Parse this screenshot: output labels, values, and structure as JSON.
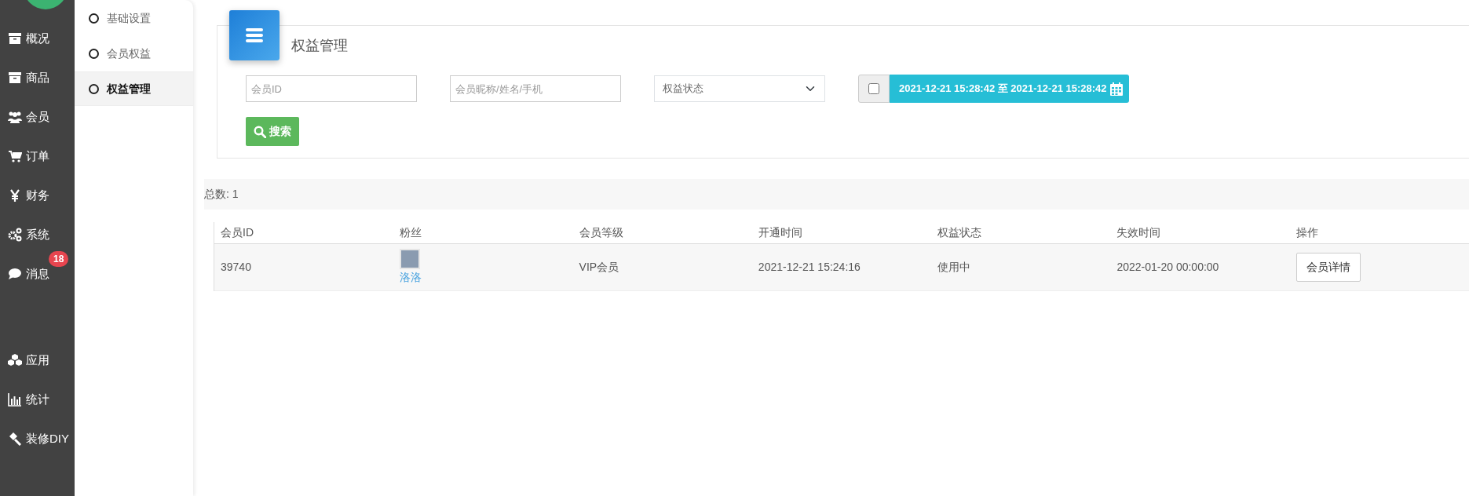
{
  "sidebar": {
    "items": [
      {
        "label": "概况"
      },
      {
        "label": "商品"
      },
      {
        "label": "会员"
      },
      {
        "label": "订单"
      },
      {
        "label": "财务"
      },
      {
        "label": "系统"
      },
      {
        "label": "消息",
        "badge": "18"
      },
      {
        "label": "应用"
      },
      {
        "label": "统计"
      },
      {
        "label": "装修DIY"
      }
    ]
  },
  "submenu": {
    "items": [
      {
        "label": "基础设置",
        "selected": false
      },
      {
        "label": "会员权益",
        "selected": false
      },
      {
        "label": "权益管理",
        "selected": true
      }
    ]
  },
  "panel": {
    "title": "权益管理",
    "filters": {
      "member_id": {
        "placeholder": "会员ID"
      },
      "member_name": {
        "placeholder": "会员昵称/姓名/手机"
      },
      "status": {
        "value": "权益状态"
      },
      "date_enabled": false,
      "date_range": "2021-12-21 15:28:42 至 2021-12-21 15:28:42"
    },
    "search_button": "搜索"
  },
  "total": {
    "label": "总数:",
    "value": "1"
  },
  "table": {
    "columns": [
      "会员ID",
      "粉丝",
      "会员等级",
      "开通时间",
      "权益状态",
      "失效时间",
      "操作"
    ],
    "rows": [
      {
        "member_id": "39740",
        "fan_name": "洛洛",
        "level": "VIP会员",
        "opened": "2021-12-21 15:24:16",
        "status": "使用中",
        "expires": "2022-01-20 00:00:00",
        "action": "会员详情"
      }
    ]
  }
}
